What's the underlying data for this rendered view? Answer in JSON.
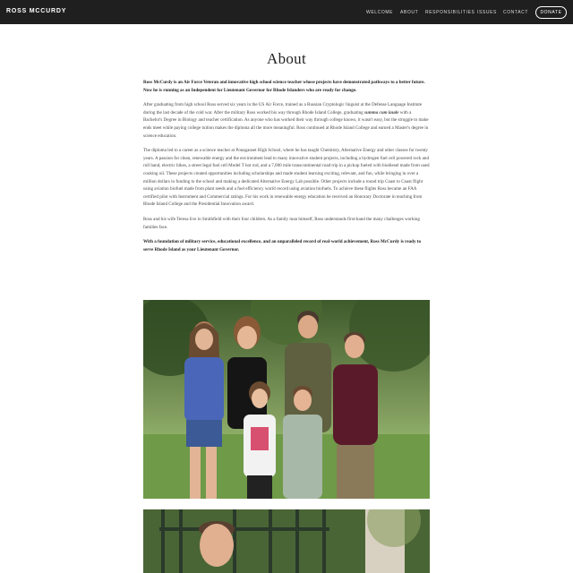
{
  "header": {
    "brand": "ROSS MCCURDY",
    "nav": [
      "WELCOME",
      "ABOUT",
      "RESPONSIBILITIES",
      "ISSUES",
      "CONTACT"
    ],
    "donate": "DONATE"
  },
  "page": {
    "title": "About",
    "intro": "Ross McCurdy is an Air Force Veteran and innovative high school science teacher whose projects have demonstrated pathways to a better future.  Now he is running as an Independent for Lieutenant Governor for Rhode Islanders who are ready for change.",
    "p1_a": "After graduating from high school Ross served six years in the US Air Force, trained as a Russian Cryptologic linguist at the Defense Language Institute during the last decade of the cold war.  After the military Ross worked his way through Rhode Island College, graduating ",
    "p1_em": "summa cum laude",
    "p1_b": " with a Bachelor's Degree in Biology and teacher certification.  As anyone who has worked their way through college knows, it wasn't easy, but the struggle to make ends meet while paying college tuition makes the diploma all the more meaningful.  Ross continued at Rhode Island College and earned a Master's degree in science education.",
    "p2": "The diploma led to a career as a science teacher at Ponaganset High School, where he has taught Chemistry, Alternative Energy and other classes for twenty years.  A passion for clean, renewable energy and the environment lead to many innovative student projects, including a hydrogen fuel cell powered rock and roll band, electric bikes, a street legal fuel cell Model T hot rod, and a 7,000 mile transcontinental road trip in a pickup fueled with biodiesel made from used cooking oil.  These projects created opportunities including scholarships and made student learning exciting, relevant, and fun, while bringing in over a million dollars in funding to the school and making a dedicated Alternative Energy Lab possible.   Other projects include a round trip Coast to Coast flight using aviation biofuel made from plant seeds and a fuel efficiency world record using aviation biofuels.  To achieve these flights Ross became an FAA certified pilot with Instrument and Commercial ratings.  For his work in renewable energy education he received an Honorary Doctorate in teaching from Rhode Island College and the Presidential Innovation award.",
    "p3": "Ross and his wife Teresa live in Smithfield with their four children.  As a family man himself, Ross understands first-hand the many challenges working families face.",
    "p4": "With a foundation of military service, educational excellence, and an unparalleled record of real-world achievement, Ross McCurdy is ready to serve Rhode Island as your Lieutenant Governor."
  }
}
